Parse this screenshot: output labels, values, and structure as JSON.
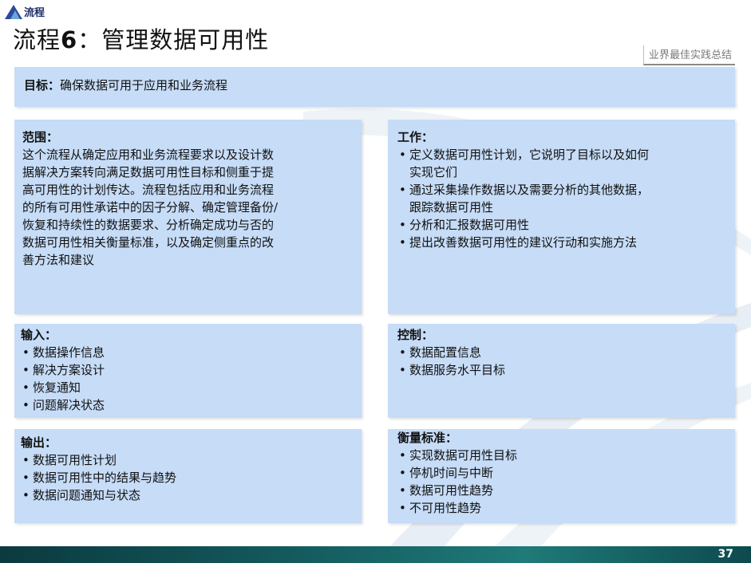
{
  "logo": {
    "text": "流程"
  },
  "title": {
    "prefix": "流程",
    "number": "6",
    "suffix": "：管理数据可用性"
  },
  "badge": "业界最佳实践总结",
  "goal": {
    "label": "目标：",
    "text": "确保数据可用于应用和业务流程"
  },
  "scope": {
    "heading": "范围：",
    "lines": [
      "这个流程从确定应用和业务流程要求以及设计数",
      "据解决方案转向满足数据可用性目标和侧重于提",
      "高可用性的计划传达。流程包括应用和业务流程",
      "的所有可用性承诺中的因子分解、确定管理备份/",
      "恢复和持续性的数据要求、分析确定成功与否的",
      "数据可用性相关衡量标准，以及确定侧重点的改",
      "善方法和建议"
    ]
  },
  "work": {
    "heading": "工作：",
    "items": [
      [
        "定义数据可用性计划，它说明了目标以及如何",
        "实现它们"
      ],
      [
        "通过采集操作数据以及需要分析的其他数据，",
        "跟踪数据可用性"
      ],
      [
        "分析和汇报数据可用性"
      ],
      [
        "提出改善数据可用性的建议行动和实施方法"
      ]
    ]
  },
  "inputs": {
    "heading": "输入：",
    "items": [
      "数据操作信息",
      "解决方案设计",
      "恢复通知",
      "问题解决状态"
    ]
  },
  "control": {
    "heading": "控制：",
    "items": [
      "数据配置信息",
      "数据服务水平目标"
    ]
  },
  "outputs": {
    "heading": "输出：",
    "items": [
      "数据可用性计划",
      "数据可用性中的结果与趋势",
      "数据问题通知与状态"
    ]
  },
  "measures": {
    "heading": "衡量标准：",
    "items": [
      "实现数据可用性目标",
      "停机时间与中断",
      "数据可用性趋势",
      "不可用性趋势"
    ]
  },
  "footer": {
    "page_number": "37"
  },
  "colors": {
    "box": "#c6dcf7",
    "footer": "#145b5e",
    "title_logo": "#1f2f6b"
  }
}
